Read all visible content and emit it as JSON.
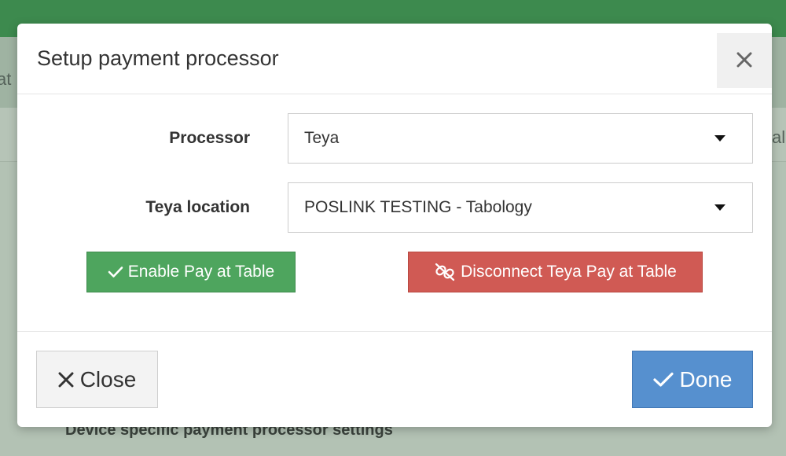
{
  "background": {
    "left_fragment": "at",
    "right_fragment": "ale",
    "section_heading": "Device specific payment processor settings"
  },
  "modal": {
    "title": "Setup payment processor",
    "close_icon": "close-icon",
    "processor": {
      "label": "Processor",
      "value": "Teya"
    },
    "location": {
      "label": "Teya location",
      "value": "POSLINK TESTING - Tabology"
    },
    "enable_button": {
      "label": "Enable Pay at Table",
      "icon": "check-icon",
      "color": "#4ea55e"
    },
    "disconnect_button": {
      "label": "Disconnect Teya Pay at Table",
      "icon": "unlink-icon",
      "color": "#d05a54"
    },
    "footer": {
      "close_label": "Close",
      "done_label": "Done",
      "done_color": "#5690cf"
    }
  }
}
